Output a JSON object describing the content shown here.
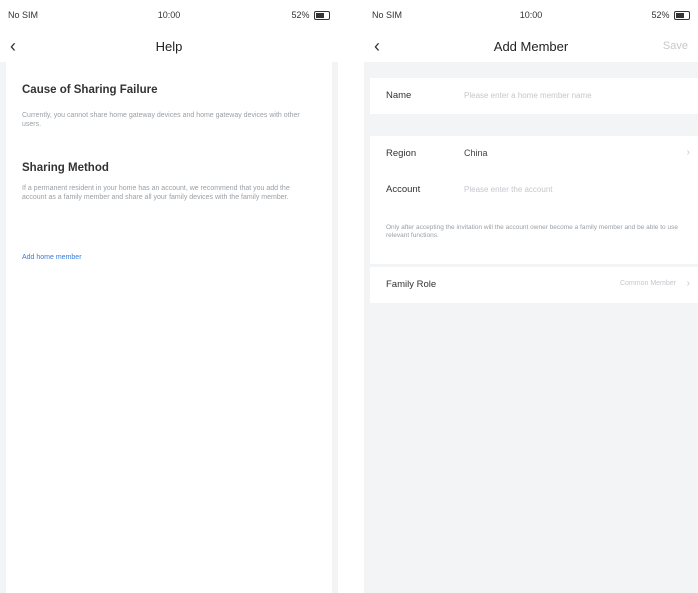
{
  "help_screen": {
    "status": {
      "left": "No SIM",
      "time": "10:00",
      "right": "52%"
    },
    "nav": {
      "title": "Help"
    },
    "sections": [
      {
        "title": "Cause of Sharing Failure",
        "text": "Currently, you cannot share home gateway devices and home gateway devices with other users."
      },
      {
        "title": "Sharing Method",
        "text": "If a permanent resident in your home has an account, we recommend that you add the account as a family member and share all your family devices with the family member."
      }
    ],
    "link": "Add home member"
  },
  "add_member_screen": {
    "status": {
      "left": "No SIM",
      "time": "10:00",
      "right": "52%"
    },
    "nav": {
      "title": "Add Member",
      "action": "Save"
    },
    "name": {
      "label": "Name",
      "placeholder": "Please enter a home member name"
    },
    "region": {
      "label": "Region",
      "value": "China"
    },
    "account": {
      "label": "Account",
      "placeholder": "Please enter the account"
    },
    "note": "Only after accepting the invitation will the account owner become a family member and be able to use relevant functions.",
    "family_role": {
      "label": "Family Role",
      "value": "Common Member"
    }
  }
}
